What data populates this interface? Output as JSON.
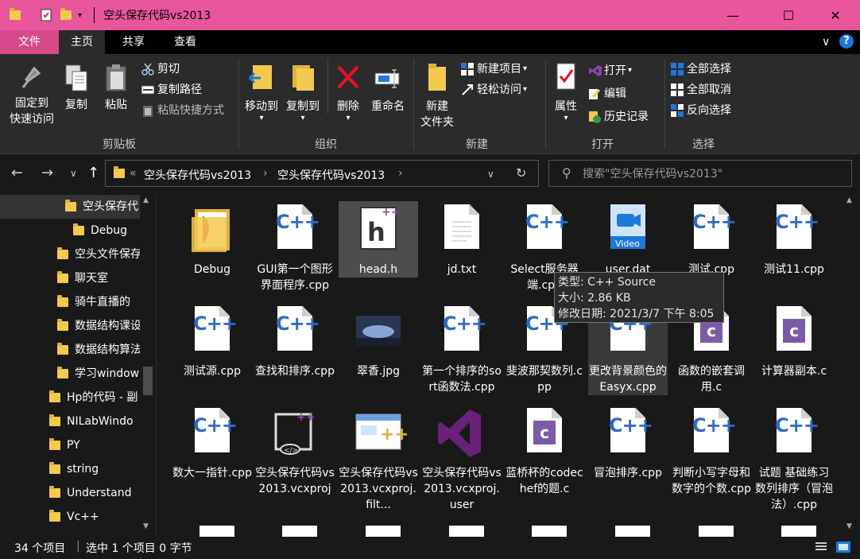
{
  "window": {
    "title": "空头保存代码vs2013",
    "minimize_label": "—",
    "maximize_label": "☐",
    "close_label": "✕"
  },
  "ribbon_tabs": {
    "file": "文件",
    "home": "主页",
    "share": "共享",
    "view": "查看"
  },
  "ribbon": {
    "clipboard": {
      "label": "剪贴板",
      "pin_line1": "固定到",
      "pin_line2": "快速访问",
      "copy": "复制",
      "paste": "粘贴",
      "cut": "剪切",
      "copy_path": "复制路径",
      "paste_shortcut": "粘贴快捷方式"
    },
    "organize": {
      "label": "组织",
      "move_to": "移动到",
      "copy_to": "复制到",
      "delete": "删除",
      "rename": "重命名"
    },
    "new": {
      "label": "新建",
      "new_folder_line1": "新建",
      "new_folder_line2": "文件夹",
      "new_item": "新建项目",
      "easy_access": "轻松访问"
    },
    "open": {
      "label": "打开",
      "properties": "属性",
      "open": "打开",
      "edit": "编辑",
      "history": "历史记录"
    },
    "select": {
      "label": "选择",
      "select_all": "全部选择",
      "select_none": "全部取消",
      "invert": "反向选择"
    }
  },
  "address": {
    "crumbs": [
      "空头保存代码vs2013",
      "空头保存代码vs2013"
    ],
    "overflow": "«"
  },
  "search": {
    "placeholder": "搜索\"空头保存代码vs2013\""
  },
  "nav_items": [
    "空头保存代",
    "Debug",
    "空头文件保存",
    "聊天室",
    "骑牛直播的",
    "数据结构课设",
    "数据结构算法",
    "学习window",
    "Hp的代码 - 副",
    "NILabWindo",
    "PY",
    "string",
    "Understand",
    "Vc++"
  ],
  "files": [
    {
      "name": "Debug",
      "type": "folder"
    },
    {
      "name": "GUI第一个图形界面程序.cpp",
      "type": "cpp"
    },
    {
      "name": "head.h",
      "type": "h"
    },
    {
      "name": "jd.txt",
      "type": "txt"
    },
    {
      "name": "Select服务器端.cpp",
      "type": "cpp"
    },
    {
      "name": "user.dat",
      "type": "video"
    },
    {
      "name": "测试.cpp",
      "type": "cpp"
    },
    {
      "name": "测试11.cpp",
      "type": "cpp"
    },
    {
      "name": "测试源.cpp",
      "type": "cpp"
    },
    {
      "name": "查找和排序.cpp",
      "type": "cpp"
    },
    {
      "name": "翠香.jpg",
      "type": "jpg"
    },
    {
      "name": "第一个排序的sort函数法.cpp",
      "type": "cpp"
    },
    {
      "name": "斐波那契数列.cpp",
      "type": "cpp"
    },
    {
      "name": "更改背景颜色的Easyx.cpp",
      "type": "cpp"
    },
    {
      "name": "函数的嵌套调用.c",
      "type": "c"
    },
    {
      "name": "计算器副本.c",
      "type": "c"
    },
    {
      "name": "数大一指针.cpp",
      "type": "cpp"
    },
    {
      "name": "空头保存代码vs2013.vcxproj",
      "type": "vcxproj"
    },
    {
      "name": "空头保存代码vs2013.vcxproj.filt...",
      "type": "filters"
    },
    {
      "name": "空头保存代码vs2013.vcxproj.user",
      "type": "vs"
    },
    {
      "name": "蓝桥杯的codechef的题.c",
      "type": "c"
    },
    {
      "name": "冒泡排序.cpp",
      "type": "cpp"
    },
    {
      "name": "判断小写字母和数字的个数.cpp",
      "type": "cpp"
    },
    {
      "name": "试题 基础练习 数列排序（冒泡法）.cpp",
      "type": "cpp"
    }
  ],
  "tooltip": {
    "type_line": "类型: C++ Source",
    "size_line": "大小: 2.86 KB",
    "date_line": "修改日期: 2021/3/7 下午 8:05"
  },
  "status": {
    "count": "34 个项目",
    "selection": "选中 1 个项目  0 字节"
  },
  "colors": {
    "titlebar": "#e8579c",
    "file_tab": "#d64a8b",
    "background": "#191919",
    "ribbon": "#2b2b2b",
    "cpp_blue": "#2f6bc1",
    "c_purple": "#7b5aa6",
    "vs_purple": "#68217a"
  }
}
